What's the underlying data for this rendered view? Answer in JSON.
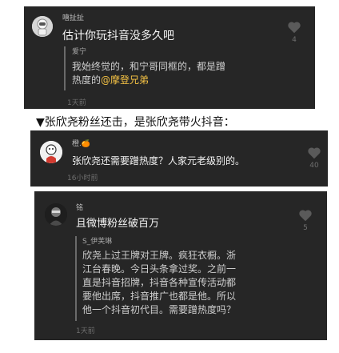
{
  "comment1": {
    "username": "嘻扯扯",
    "text": "估计你玩抖音没多久吧",
    "likes": "4",
    "reply": {
      "username": "爱宁",
      "line1": "我始终觉的，和宁哥同框的，都是蹭",
      "line2_prefix": "热度的",
      "mention": "@摩登兄弟"
    },
    "time": "1天前"
  },
  "caption": "▼张欣尧粉丝还击，是张欣尧带火抖音：",
  "comment2": {
    "username": "橙.🍊",
    "text": "张欣尧还需要蹭热度？人家元老级别的。",
    "likes": "40",
    "time": "16小时前"
  },
  "comment3": {
    "username": "铭",
    "text": "且微博粉丝破百万",
    "likes": "5",
    "reply": {
      "username": "S_伊芙琳",
      "lines": [
        "欣尧上过王牌对王牌。疯狂衣橱。浙",
        "江台春晚。今日头条拿过奖。之前一",
        "直是抖音招牌，抖音各种宣传活动都",
        "要他出席，抖音推广也都是他。所以",
        "他一个抖音初代目。需要蹭热度吗？"
      ]
    },
    "time": "1天前"
  },
  "icons": {
    "like": "heart-icon",
    "avatar1": "avatar-astronaut",
    "avatar2": "avatar-cartoon",
    "avatar3": "avatar-dark-portrait"
  },
  "colors": {
    "card_bg": "#262626",
    "mention": "#f6c344",
    "heart": "#5a5a5a"
  }
}
